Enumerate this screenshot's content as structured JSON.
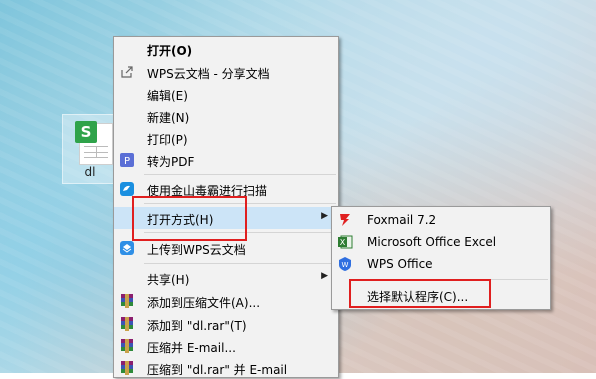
{
  "desktop": {
    "file": {
      "name": "dl",
      "badge": "S"
    }
  },
  "context_menu": {
    "items": [
      {
        "label": "打开(O)",
        "icon": "none"
      },
      {
        "label": "WPS云文档 - 分享文档",
        "icon": "share-icon"
      },
      {
        "label": "编辑(E)",
        "icon": "none"
      },
      {
        "label": "新建(N)",
        "icon": "none"
      },
      {
        "label": "打印(P)",
        "icon": "none"
      },
      {
        "label": "转为PDF",
        "icon": "pdf-convert-icon"
      },
      {
        "label": "使用金山毒霸进行扫描",
        "icon": "antivirus-icon"
      },
      {
        "label": "打开方式(H)",
        "icon": "none",
        "has_submenu": true,
        "highlighted": true
      },
      {
        "label": "上传到WPS云文档",
        "icon": "cloud-upload-icon"
      },
      {
        "label": "共享(H)",
        "icon": "none",
        "has_submenu": true
      },
      {
        "label": "添加到压缩文件(A)...",
        "icon": "winrar-icon"
      },
      {
        "label": "添加到 \"dl.rar\"(T)",
        "icon": "winrar-icon"
      },
      {
        "label": "压缩并 E-mail...",
        "icon": "winrar-icon"
      },
      {
        "label": "压缩到 \"dl.rar\" 并 E-mail",
        "icon": "winrar-icon"
      }
    ],
    "arrow": "▶"
  },
  "open_with_submenu": {
    "items": [
      {
        "label": "Foxmail 7.2",
        "icon": "foxmail-icon"
      },
      {
        "label": "Microsoft Office Excel",
        "icon": "excel-icon"
      },
      {
        "label": "WPS Office",
        "icon": "wps-icon"
      },
      {
        "label": "选择默认程序(C)...",
        "icon": "none"
      }
    ]
  },
  "colors": {
    "menu_bg": "#f2f2f2",
    "highlight": "#cce4f7",
    "annotation_red": "#e01f1f",
    "wps_green": "#2fa34a"
  }
}
